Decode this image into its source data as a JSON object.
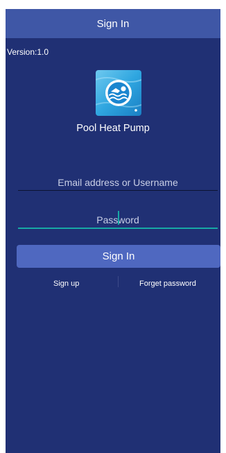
{
  "header": {
    "title": "Sign In"
  },
  "version": "Version:1.0",
  "app": {
    "name": "Pool Heat Pump",
    "icon": "swimmer-icon"
  },
  "form": {
    "email_placeholder": "Email address or Username",
    "password_placeholder": "Password",
    "signin_label": "Sign In"
  },
  "links": {
    "sign_up": "Sign up",
    "forget_password": "Forget password"
  },
  "colors": {
    "background": "#203074",
    "header": "#3f57a6",
    "button": "#4f68c0",
    "focus_accent": "#17a9a5"
  }
}
